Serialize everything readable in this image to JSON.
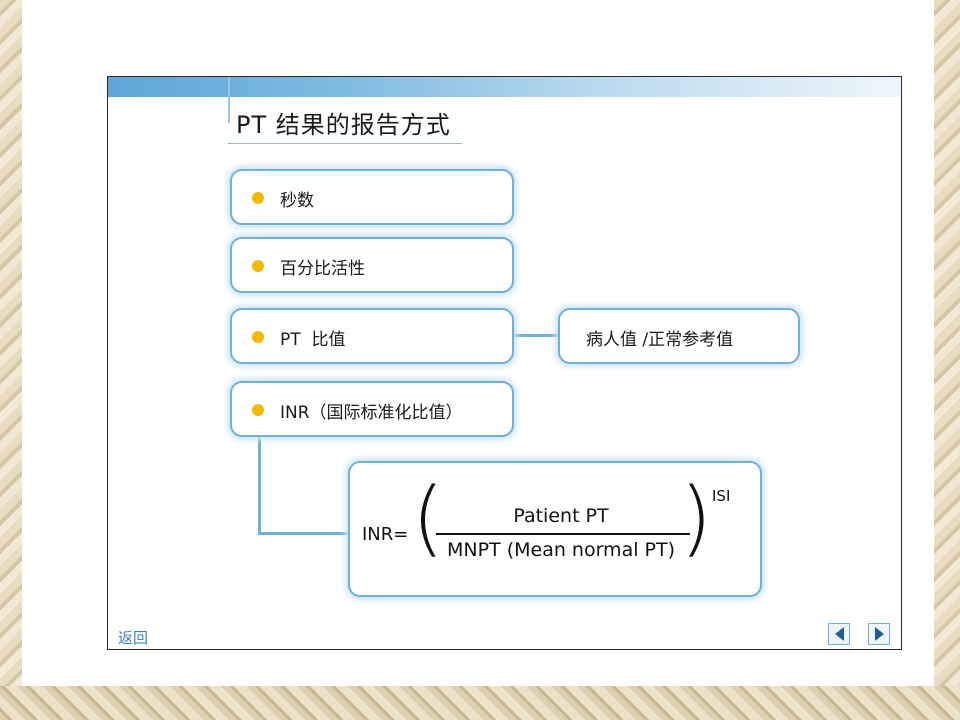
{
  "slide": {
    "title": "PT 结果的报告方式",
    "items": [
      {
        "label": "秒数"
      },
      {
        "label": "百分比活性"
      },
      {
        "label": "PT  比值"
      },
      {
        "label": "INR（国际标准化比值）"
      }
    ],
    "pt_ratio_definition": "病人值 /正常参考值",
    "formula": {
      "lhs": "INR=",
      "numerator": "Patient PT",
      "denominator": "MNPT (Mean normal PT)",
      "exponent": "ISI",
      "open_paren": "(",
      "close_paren": ")"
    },
    "return_label": "返回"
  },
  "colors": {
    "accent_blue": "#6fb0dc",
    "bullet_yellow": "#f5b800",
    "nav_blue": "#1f5f98",
    "link_blue": "#3f86c0"
  },
  "icons": {
    "prev": "triangle-left-icon",
    "next": "triangle-right-icon"
  }
}
